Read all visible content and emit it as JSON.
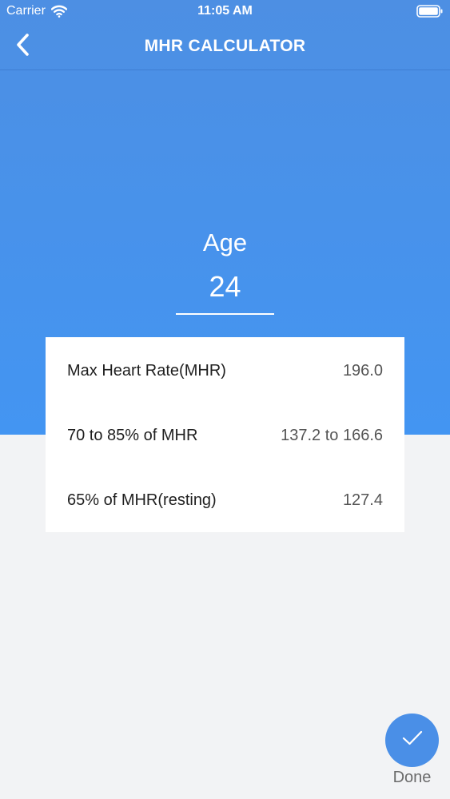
{
  "status_bar": {
    "carrier": "Carrier",
    "time": "11:05 AM",
    "icons": [
      "wifi-icon",
      "battery-icon"
    ]
  },
  "nav": {
    "title": "MHR CALCULATOR",
    "back_icon": "chevron-left-icon"
  },
  "age": {
    "label": "Age",
    "value": "24"
  },
  "results": [
    {
      "label": "Max Heart Rate(MHR)",
      "value": "196.0"
    },
    {
      "label": "70 to 85% of MHR",
      "value": "137.2 to 166.6"
    },
    {
      "label": "65% of MHR(resting)",
      "value": "127.4"
    }
  ],
  "done": {
    "label": "Done",
    "icon": "checkmark-icon"
  },
  "colors": {
    "accent": "#4395f2",
    "background": "#f2f3f5",
    "card": "#ffffff",
    "done_button": "#4a8fe7"
  }
}
